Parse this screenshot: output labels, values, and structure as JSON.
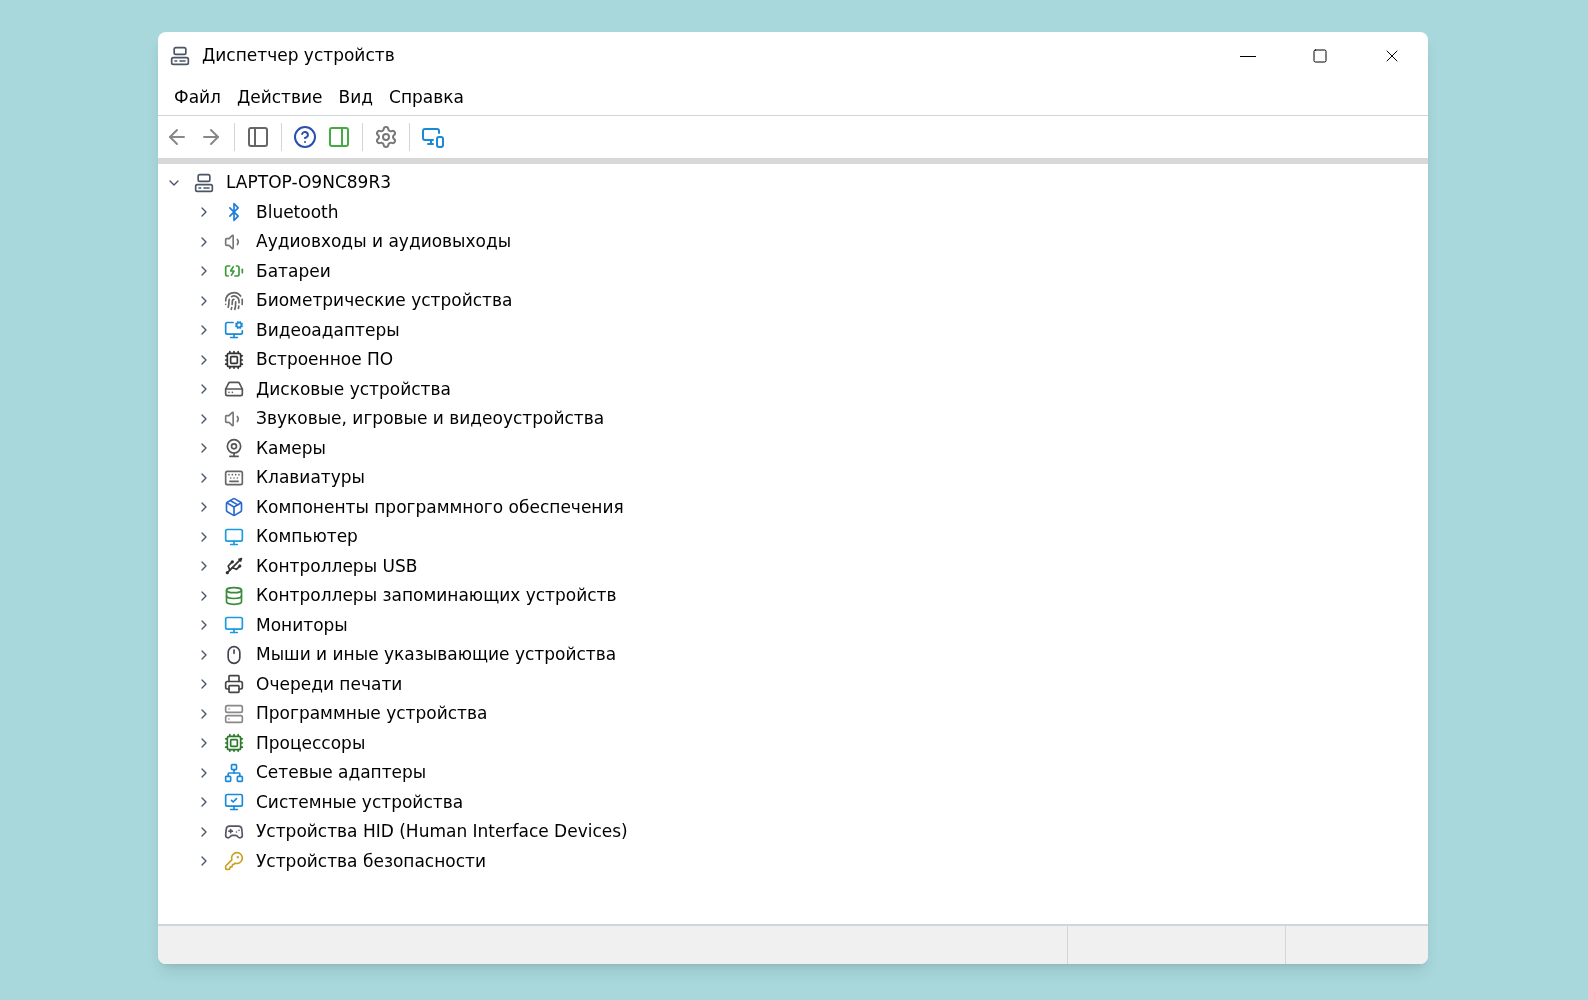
{
  "window": {
    "title": "Диспетчер устройств"
  },
  "menu": [
    "Файл",
    "Действие",
    "Вид",
    "Справка"
  ],
  "tree": {
    "label": "LAPTOP-O9NC89R3",
    "expanded": true,
    "children": [
      {
        "label": "Bluetooth",
        "expanded": false
      },
      {
        "label": "Аудиовходы и аудиовыходы",
        "expanded": false
      },
      {
        "label": "Батареи",
        "expanded": false
      },
      {
        "label": "Биометрические устройства",
        "expanded": false
      },
      {
        "label": "Видеоадаптеры",
        "expanded": false
      },
      {
        "label": "Встроенное ПО",
        "expanded": false
      },
      {
        "label": "Дисковые устройства",
        "expanded": false
      },
      {
        "label": "Звуковые, игровые и видеоустройства",
        "expanded": false
      },
      {
        "label": "Камеры",
        "expanded": false
      },
      {
        "label": "Клавиатуры",
        "expanded": false
      },
      {
        "label": "Компоненты программного обеспечения",
        "expanded": false
      },
      {
        "label": "Компьютер",
        "expanded": false
      },
      {
        "label": "Контроллеры USB",
        "expanded": false
      },
      {
        "label": "Контроллеры запоминающих устройств",
        "expanded": false
      },
      {
        "label": "Мониторы",
        "expanded": false
      },
      {
        "label": "Мыши и иные указывающие устройства",
        "expanded": false
      },
      {
        "label": "Очереди печати",
        "expanded": false
      },
      {
        "label": "Программные устройства",
        "expanded": false
      },
      {
        "label": "Процессоры",
        "expanded": false
      },
      {
        "label": "Сетевые адаптеры",
        "expanded": false
      },
      {
        "label": "Системные устройства",
        "expanded": false
      },
      {
        "label": "Устройства HID (Human Interface Devices)",
        "expanded": false
      },
      {
        "label": "Устройства безопасности",
        "expanded": false
      }
    ]
  }
}
